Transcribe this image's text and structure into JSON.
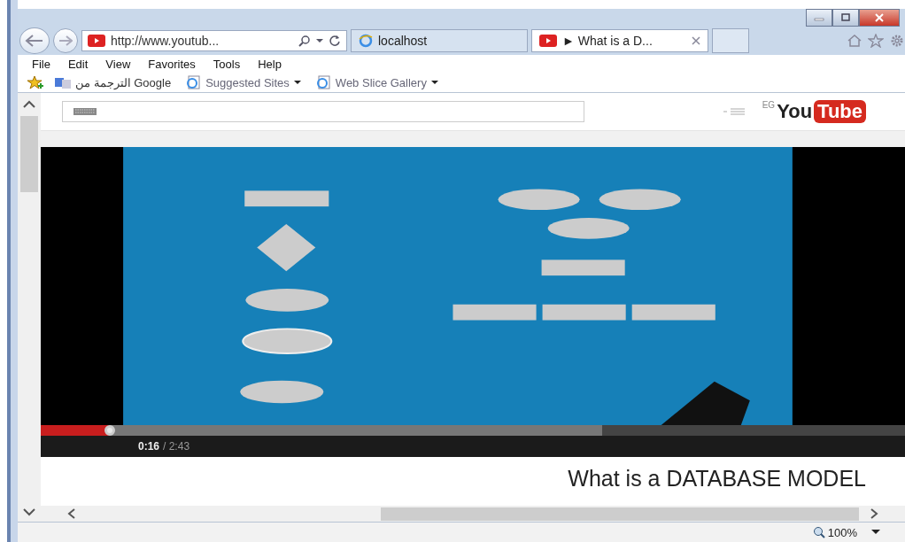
{
  "browser": {
    "address": "http://www.youtub...",
    "tabs": [
      {
        "label": "localhost",
        "selected": false
      },
      {
        "label": "► What is a D...",
        "selected": true
      }
    ],
    "menu": [
      "File",
      "Edit",
      "View",
      "Favorites",
      "Tools",
      "Help"
    ],
    "favorites": [
      {
        "label": "الترجمة من Google",
        "kind": "translate"
      },
      {
        "label": "Suggested Sites",
        "kind": "dropdown"
      },
      {
        "label": "Web Slice Gallery",
        "kind": "dropdown"
      }
    ]
  },
  "page": {
    "logo": {
      "region": "EG",
      "left": "You",
      "right": "Tube"
    },
    "video": {
      "progress": {
        "level": 0.08
      },
      "buffered": {
        "level": 0.65
      },
      "time_current": "0:16",
      "time_total": "/ 2:43"
    },
    "title": "What is a DATABASE MODEL"
  },
  "status_bar": {
    "zoom": "100%"
  }
}
